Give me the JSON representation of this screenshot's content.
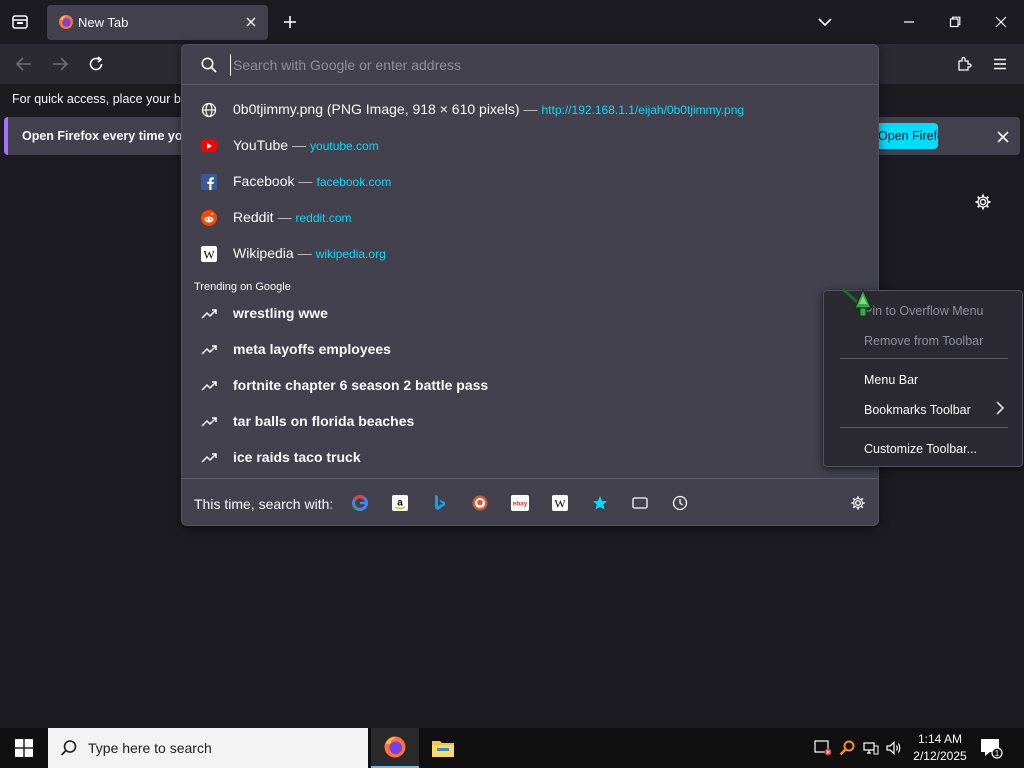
{
  "tab": {
    "title": "New Tab"
  },
  "bookmarks_hint": "For quick access, place your bookmarks here on the bookmarks toolbar.",
  "notification": {
    "message": "Open Firefox every time you restart your computer",
    "cta": "Open Firefox"
  },
  "urlbar": {
    "placeholder": "Search with Google or enter address",
    "results": [
      {
        "icon": "globe-icon",
        "title": "0b0tjimmy.png (PNG Image, 918 × 610 pixels)",
        "sep": "—",
        "url": "http://192.168.1.1/eijah/0b0tjimmy.png"
      },
      {
        "icon": "youtube-icon",
        "title": "YouTube",
        "sep": "—",
        "url": "youtube.com"
      },
      {
        "icon": "facebook-icon",
        "title": "Facebook",
        "sep": "—",
        "url": "facebook.com"
      },
      {
        "icon": "reddit-icon",
        "title": "Reddit",
        "sep": "—",
        "url": "reddit.com"
      },
      {
        "icon": "wikipedia-icon",
        "title": "Wikipedia",
        "sep": "—",
        "url": "wikipedia.org"
      }
    ],
    "trending_heading": "Trending on Google",
    "trending": [
      "wrestling wwe",
      "meta layoffs employees",
      "fortnite chapter 6 season 2 battle pass",
      "tar balls on florida beaches",
      "ice raids taco truck"
    ],
    "oneoff_label": "This time, search with:",
    "engines": [
      "google-icon",
      "amazon-icon",
      "bing-icon",
      "duckduckgo-icon",
      "ebay-icon",
      "wikipedia-icon",
      "bookmarks-star-icon",
      "tabs-icon",
      "history-icon"
    ]
  },
  "context_menu": {
    "items": [
      "Pin to Overflow Menu",
      "Remove from Toolbar",
      "Menu Bar",
      "Bookmarks Toolbar",
      "Customize Toolbar..."
    ]
  },
  "taskbar": {
    "search_placeholder": "Type here to search",
    "time": "1:14 AM",
    "date": "2/12/2025"
  },
  "colors": {
    "accent": "#00ddff",
    "notification_border": "#a371ff",
    "page_bg": "#1c1b22",
    "panel_bg": "#42414d"
  }
}
